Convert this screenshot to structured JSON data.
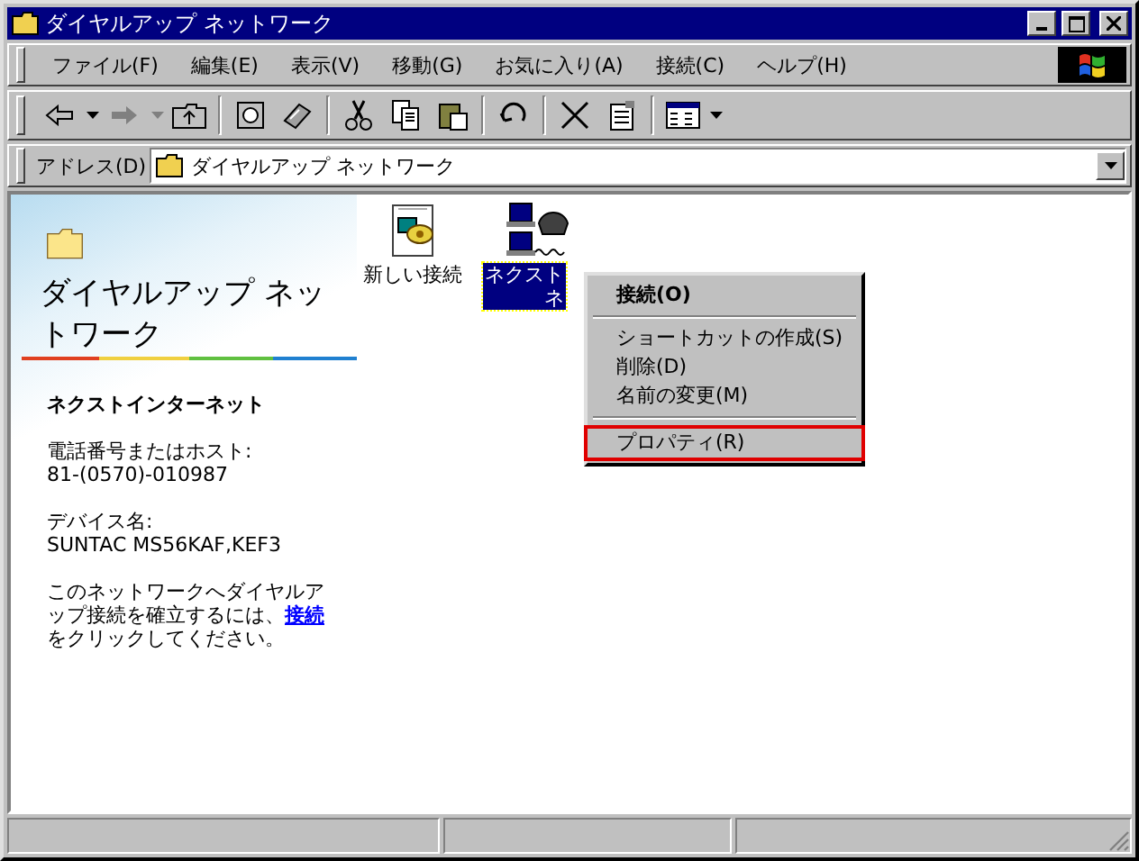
{
  "window": {
    "title": "ダイヤルアップ ネットワーク"
  },
  "menu_bar": [
    "ファイル(F)",
    "編集(E)",
    "表示(V)",
    "移動(G)",
    "お気に入り(A)",
    "接続(C)",
    "ヘルプ(H)"
  ],
  "address_bar": {
    "label": "アドレス(D)",
    "value": "ダイヤルアップ ネットワーク"
  },
  "sidebar": {
    "title": "ダイヤルアップ ネットワーク",
    "name": "ネクストインターネット",
    "details": [
      {
        "label": "電話番号またはホスト:",
        "value": "81-(0570)-010987"
      },
      {
        "label": "デバイス名:",
        "value": "SUNTAC MS56KAF,KEF3"
      }
    ],
    "instruction": {
      "before": "このネットワークへダイヤルアップ接続を確立するには、",
      "link": "接続",
      "after": "をクリックしてください。"
    }
  },
  "icons": [
    {
      "kind": "new",
      "label_lines": [
        "新しい接続"
      ],
      "selected": false
    },
    {
      "kind": "connection",
      "label_lines": [
        "ネクスト",
        "ネ"
      ],
      "selected": true
    }
  ],
  "context_menu": [
    {
      "kind": "item",
      "label": "接続(O)",
      "default": true,
      "highlighted": false
    },
    {
      "kind": "separator"
    },
    {
      "kind": "item",
      "label": "ショートカットの作成(S)",
      "default": false,
      "highlighted": false
    },
    {
      "kind": "item",
      "label": "削除(D)",
      "default": false,
      "highlighted": false
    },
    {
      "kind": "item",
      "label": "名前の変更(M)",
      "default": false,
      "highlighted": false
    },
    {
      "kind": "separator"
    },
    {
      "kind": "item",
      "label": "プロパティ(R)",
      "default": false,
      "highlighted": true
    }
  ]
}
